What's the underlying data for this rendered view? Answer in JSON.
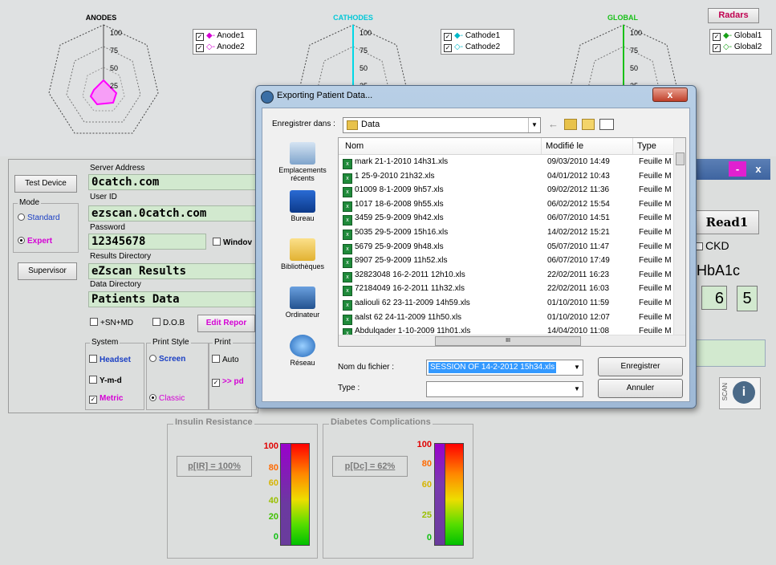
{
  "radars": {
    "anodes": {
      "title": "ANODES",
      "color": "#ff00ff",
      "ticks": [
        "100",
        "75",
        "50",
        "25"
      ],
      "legend": [
        "Anode1",
        "Anode2"
      ]
    },
    "cathodes": {
      "title": "CATHODES",
      "color": "#00d8e6",
      "ticks": [
        "100",
        "75",
        "50",
        "25"
      ],
      "legend": [
        "Cathode1",
        "Cathode2"
      ]
    },
    "global": {
      "title": "GLOBAL",
      "color": "#18c018",
      "ticks": [
        "100",
        "75",
        "50",
        "25"
      ],
      "legend": [
        "Global1",
        "Global2"
      ]
    },
    "radars_button": "Radars"
  },
  "left_panel": {
    "test_device": "Test Device",
    "mode_label": "Mode",
    "mode_standard": "Standard",
    "mode_expert": "Expert",
    "supervisor": "Supervisor",
    "server_address_label": "Server Address",
    "server_address": "0catch.com",
    "user_id_label": "User ID",
    "user_id": "ezscan.0catch.com",
    "password_label": "Password",
    "password": "12345678",
    "window_chk": "Windov",
    "results_dir_label": "Results Directory",
    "results_dir": "eZscan Results",
    "data_dir_label": "Data Directory",
    "data_dir": "Patients Data",
    "sn_md": "+SN+MD",
    "dob": "D.O.B",
    "edit_report": "Edit Repor",
    "system_label": "System",
    "headset": "Headset",
    "ymd": "Y-m-d",
    "metric": "Metric",
    "print_style_label": "Print Style",
    "screen": "Screen",
    "classic": "Classic",
    "print_label": "Print",
    "auto": "Auto",
    "pdf": ">> pd"
  },
  "right_panel": {
    "read1": "Read1",
    "ckd": "CKD",
    "hba1c_label": "HbA1c",
    "hba1c_int": "6",
    "hba1c_dec": "5",
    "scan_label": "SCAN",
    "minimize": "-",
    "close": "x"
  },
  "meters": [
    {
      "group": "Insulin Resistance",
      "value_text": "p[IR] = 100%",
      "percent": 100,
      "scale": [
        "100",
        "80",
        "60",
        "40",
        "20",
        "0"
      ]
    },
    {
      "group": "Diabetes Complications",
      "value_text": "p[Dc] = 62%",
      "percent": 62,
      "scale": [
        "100",
        "80",
        "60",
        "25",
        "0"
      ]
    }
  ],
  "dialog": {
    "title": "Exporting Patient Data...",
    "save_in_label": "Enregistrer dans :",
    "save_in_value": "Data",
    "places": [
      "Emplacements récents",
      "Bureau",
      "Bibliothèques",
      "Ordinateur",
      "Réseau"
    ],
    "columns": [
      "Nom",
      "Modifié le",
      "Type"
    ],
    "files": [
      {
        "name": "mark 21-1-2010 14h31.xls",
        "date": "09/03/2010 14:49",
        "type": "Feuille M"
      },
      {
        "name": "1 25-9-2010 21h32.xls",
        "date": "04/01/2012 10:43",
        "type": "Feuille M"
      },
      {
        "name": "01009 8-1-2009 9h57.xls",
        "date": "09/02/2012 11:36",
        "type": "Feuille M"
      },
      {
        "name": "1017 18-6-2008 9h55.xls",
        "date": "06/02/2012 15:54",
        "type": "Feuille M"
      },
      {
        "name": "3459 25-9-2009 9h42.xls",
        "date": "06/07/2010 14:51",
        "type": "Feuille M"
      },
      {
        "name": "5035 29-5-2009 15h16.xls",
        "date": "14/02/2012 15:21",
        "type": "Feuille M"
      },
      {
        "name": "5679 25-9-2009 9h48.xls",
        "date": "05/07/2010 11:47",
        "type": "Feuille M"
      },
      {
        "name": "8907 25-9-2009 11h52.xls",
        "date": "06/07/2010 17:49",
        "type": "Feuille M"
      },
      {
        "name": "32823048 16-2-2011 12h10.xls",
        "date": "22/02/2011 16:23",
        "type": "Feuille M"
      },
      {
        "name": "72184049 16-2-2011 11h32.xls",
        "date": "22/02/2011 16:03",
        "type": "Feuille M"
      },
      {
        "name": "aaliouli 62 23-11-2009 14h59.xls",
        "date": "01/10/2010 11:59",
        "type": "Feuille M"
      },
      {
        "name": "aalst 62 24-11-2009 11h50.xls",
        "date": "01/10/2010 12:07",
        "type": "Feuille M"
      },
      {
        "name": "Abdulqader 1-10-2009 11h01.xls",
        "date": "14/04/2010 11:08",
        "type": "Feuille M"
      }
    ],
    "filename_label": "Nom du fichier :",
    "filename_value": "SESSION OF 14-2-2012 15h34.xls",
    "type_label": "Type :",
    "type_value": "",
    "save_button": "Enregistrer",
    "cancel_button": "Annuler",
    "close_button": "x",
    "scroll_mark": "III"
  }
}
